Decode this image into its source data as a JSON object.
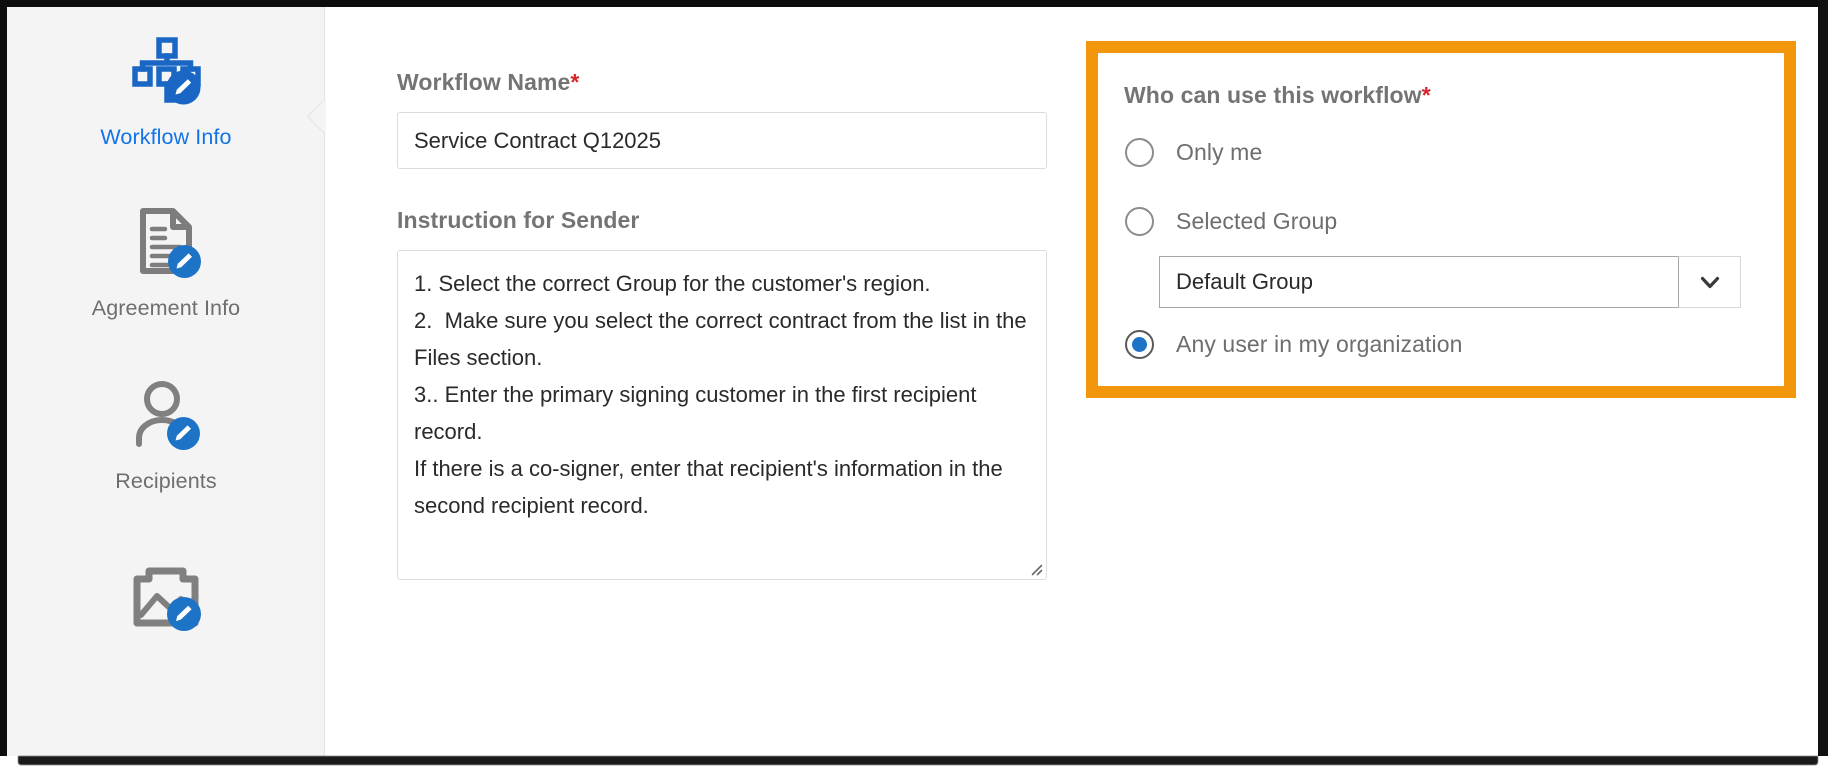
{
  "sidebar": {
    "items": [
      {
        "label": "Workflow Info",
        "icon": "workflow-edit-icon",
        "active": true
      },
      {
        "label": "Agreement Info",
        "icon": "document-edit-icon",
        "active": false
      },
      {
        "label": "Recipients",
        "icon": "user-edit-icon",
        "active": false
      },
      {
        "label": "",
        "icon": "image-edit-icon",
        "active": false
      }
    ],
    "active_color": "#1473e6",
    "inactive_color": "#6e6e6e",
    "background": "#f4f4f4"
  },
  "form": {
    "workflow_name": {
      "label": "Workflow Name",
      "required_marker": "*",
      "value": "Service Contract Q12025",
      "placeholder": ""
    },
    "instruction_for_sender": {
      "label": "Instruction for Sender",
      "value": "1. Select the correct Group for the customer's region.\n2.  Make sure you select the correct contract from the list in the Files section.\n3.. Enter the primary signing customer in the first recipient record.\nIf there is a co-signer, enter that recipient's information in the second recipient record.",
      "placeholder": ""
    }
  },
  "who_panel": {
    "highlight_color": "#f2960b",
    "title": "Who can use this workflow",
    "required_marker": "*",
    "options": [
      {
        "label": "Only me",
        "selected": false
      },
      {
        "label": "Selected Group",
        "selected": false
      },
      {
        "label": "Any user in my organization",
        "selected": true
      }
    ],
    "group_select": {
      "value": "Default Group",
      "options": [
        "Default Group"
      ],
      "chevron_icon": "chevron-down-icon"
    },
    "selected_radio_color": "#1d73c6"
  }
}
